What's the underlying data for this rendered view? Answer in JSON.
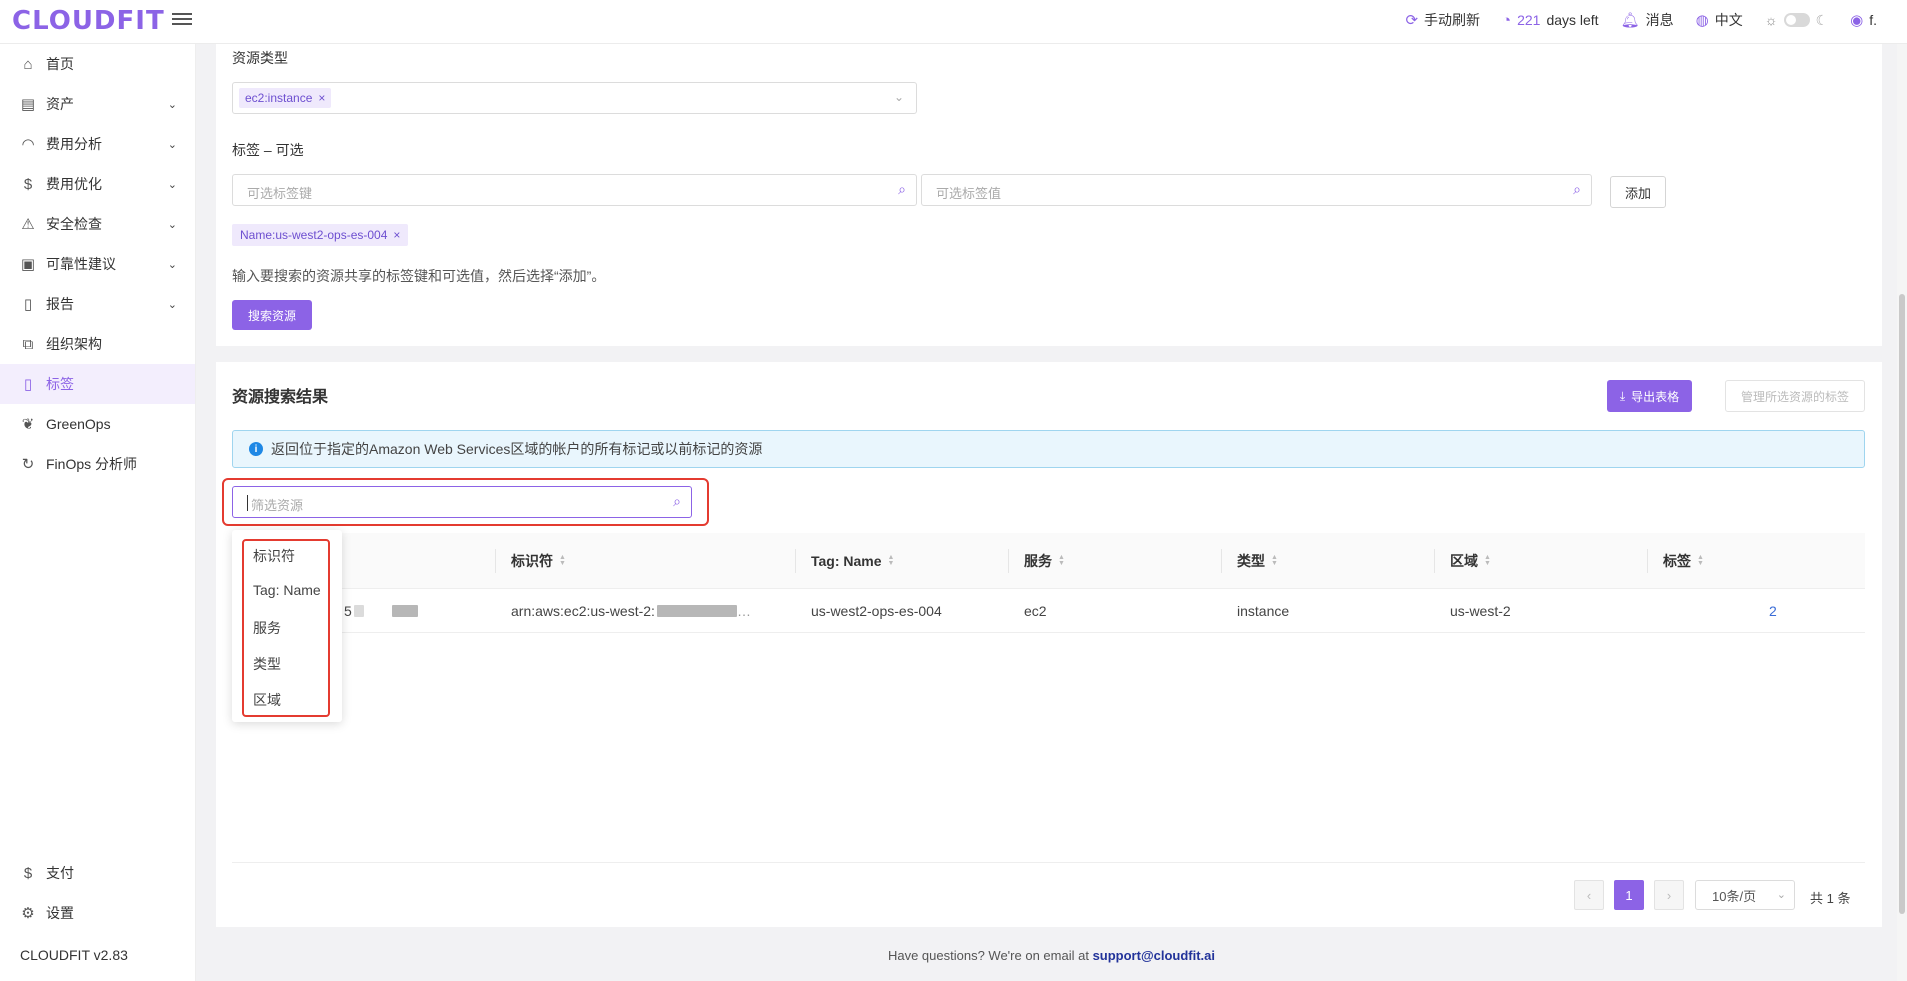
{
  "app": {
    "logo": "CLOUDFIT",
    "version": "CLOUDFIT v2.83"
  },
  "topbar": {
    "refresh": "手动刷新",
    "days_num": "221",
    "days_text": "days left",
    "messages": "消息",
    "language": "中文",
    "user": "f."
  },
  "sidebar": {
    "items": [
      {
        "label": "首页",
        "icon": "home-icon"
      },
      {
        "label": "资产",
        "icon": "asset-icon"
      },
      {
        "label": "费用分析",
        "icon": "gauge-icon"
      },
      {
        "label": "费用优化",
        "icon": "dollar-icon"
      },
      {
        "label": "安全检查",
        "icon": "alarm-icon"
      },
      {
        "label": "可靠性建议",
        "icon": "reliability-icon"
      },
      {
        "label": "报告",
        "icon": "report-icon"
      },
      {
        "label": "组织架构",
        "icon": "org-icon"
      },
      {
        "label": "标签",
        "icon": "tag-icon"
      },
      {
        "label": "GreenOps",
        "icon": "leaf-icon"
      },
      {
        "label": "FinOps 分析师",
        "icon": "analyst-icon"
      }
    ],
    "bottom": [
      {
        "label": "支付",
        "icon": "pay-icon"
      },
      {
        "label": "设置",
        "icon": "settings-icon"
      }
    ]
  },
  "search": {
    "resource_type_label": "资源类型",
    "resource_type_chip": "ec2:instance",
    "tags_label": "标签 – 可选",
    "tag_key_placeholder": "可选标签键",
    "tag_value_placeholder": "可选标签值",
    "add_button": "添加",
    "tag_chip": "Name:us-west2-ops-es-004",
    "hint": "输入要搜索的资源共享的标签键和可选值，然后选择“添加”。",
    "search_button": "搜索资源"
  },
  "results": {
    "title": "资源搜索结果",
    "export_button": "导出表格",
    "manage_button": "管理所选资源的标签",
    "info": "返回位于指定的Amazon Web Services区域的帐户的所有标记或以前标记的资源",
    "filter_placeholder": "筛选资源",
    "columns": [
      "标识符",
      "Tag: Name",
      "服务",
      "类型",
      "区域",
      "标签"
    ],
    "rows": [
      {
        "id_partial": "5",
        "arn": "arn:aws:ec2:us-west-2:",
        "name": "us-west2-ops-es-004",
        "service": "ec2",
        "type": "instance",
        "region": "us-west-2",
        "tags": "2"
      }
    ],
    "filter_options": [
      "标识符",
      "Tag: Name",
      "服务",
      "类型",
      "区域"
    ]
  },
  "pagination": {
    "current": "1",
    "page_size": "10条/页",
    "total": "共 1 条"
  },
  "footer": {
    "text": "Have questions? We're on email at",
    "email": "support@cloudfit.ai"
  }
}
